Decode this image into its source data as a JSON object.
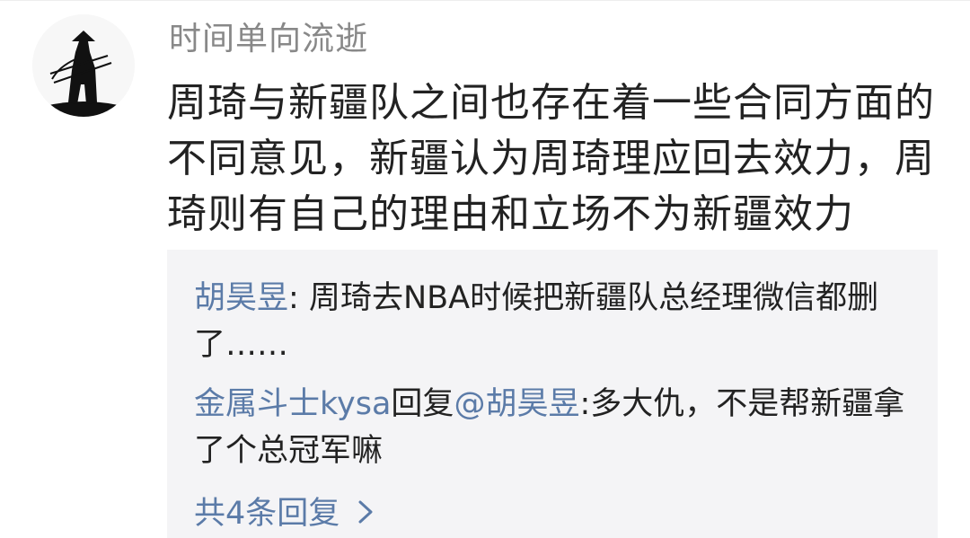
{
  "comment": {
    "author": "时间单向流逝",
    "text": "周琦与新疆队之间也存在着一些合同方面的不同意见，新疆认为周琦理应回去效力，周琦则有自己的理由和立场不为新疆效力"
  },
  "replies": [
    {
      "author": "胡昊昱",
      "separator": ": ",
      "text": "周琦去NBA时候把新疆队总经理微信都删了……"
    },
    {
      "author": "金属斗士kysa",
      "reply_word": "回复",
      "reply_target": "@胡昊昱",
      "separator": ":",
      "text": "多大仇，不是帮新疆拿了个总冠军嘛"
    }
  ],
  "more_replies": {
    "label": "共4条回复",
    "icon": "chevron-right-icon"
  },
  "colors": {
    "link": "#5b7ba8",
    "author": "#888888",
    "text": "#222222",
    "reply_bg": "#f4f4f6"
  }
}
